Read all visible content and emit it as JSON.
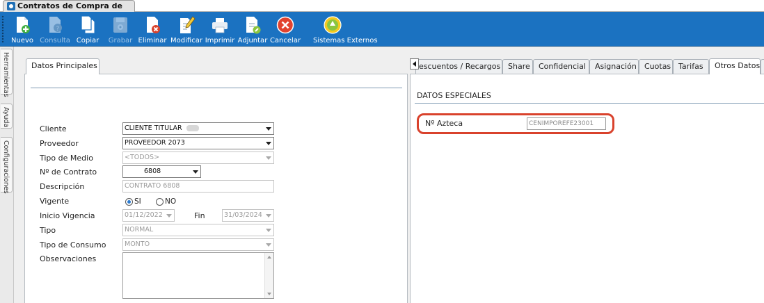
{
  "window": {
    "title": "Contratos de Compra de Medios"
  },
  "toolbar": {
    "buttons": [
      {
        "label": "Nuevo",
        "icon": "new-doc-plus-icon",
        "enabled": true
      },
      {
        "label": "Consulta",
        "icon": "doc-query-icon",
        "enabled": false
      },
      {
        "label": "Copiar",
        "icon": "copy-icon",
        "enabled": true
      },
      {
        "label": "Grabar",
        "icon": "save-disk-icon",
        "enabled": false
      },
      {
        "label": "Eliminar",
        "icon": "doc-delete-icon",
        "enabled": true
      },
      {
        "label": "Modificar",
        "icon": "doc-edit-pencil-icon",
        "enabled": true
      },
      {
        "label": "Imprimir",
        "icon": "printer-icon",
        "enabled": true
      },
      {
        "label": "Adjuntar",
        "icon": "attach-icon",
        "enabled": true
      },
      {
        "label": "Cancelar",
        "icon": "cancel-x-icon",
        "enabled": true
      },
      {
        "label": "Sistemas Externos",
        "icon": "external-systems-icon",
        "enabled": true
      }
    ]
  },
  "side_tabs": [
    "Herramientas",
    "Ayuda",
    "Configuraciones"
  ],
  "left_panel": {
    "tab": "Datos Principales",
    "fields": {
      "cliente": {
        "label": "Cliente",
        "value": "CLIENTE TITULAR"
      },
      "proveedor": {
        "label": "Proveedor",
        "value": "PROVEEDOR 2073"
      },
      "tipo_medio": {
        "label": "Tipo de Medio",
        "value": "<TODOS>"
      },
      "contrato": {
        "label": "Nº de Contrato",
        "value": "6808"
      },
      "descripcion": {
        "label": "Descripción",
        "value": "CONTRATO 6808"
      },
      "vigente": {
        "label": "Vigente",
        "si": "SI",
        "no": "NO",
        "selected": "SI"
      },
      "inicio": {
        "label": "Inicio Vigencia",
        "value": "01/12/2022"
      },
      "fin": {
        "label": "Fin",
        "value": "31/03/2024"
      },
      "tipo": {
        "label": "Tipo",
        "value": "NORMAL"
      },
      "tipo_consumo": {
        "label": "Tipo de Consumo",
        "value": "MONTO"
      },
      "observaciones": {
        "label": "Observaciones",
        "value": ""
      }
    }
  },
  "right_panel": {
    "tabs": [
      "escuentos / Recargos",
      "Share",
      "Confidencial",
      "Asignación",
      "Cuotas",
      "Tarifas",
      "Otros Datos"
    ],
    "active_tab": "Otros Datos",
    "section_title": "DATOS ESPECIALES",
    "azteca": {
      "label": "Nº Azteca",
      "value": "CENIMPOREFE23001"
    }
  },
  "colors": {
    "toolbar": "#1b72c1",
    "highlight": "#d9422c"
  }
}
